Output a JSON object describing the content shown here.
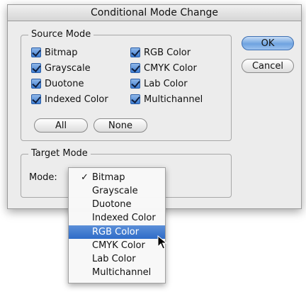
{
  "dialog": {
    "title": "Conditional Mode Change"
  },
  "source_mode": {
    "title": "Source Mode",
    "items": [
      {
        "label": "Bitmap",
        "checked": true
      },
      {
        "label": "Grayscale",
        "checked": true
      },
      {
        "label": "Duotone",
        "checked": true
      },
      {
        "label": "Indexed Color",
        "checked": true
      },
      {
        "label": "RGB Color",
        "checked": true
      },
      {
        "label": "CMYK Color",
        "checked": true
      },
      {
        "label": "Lab Color",
        "checked": true
      },
      {
        "label": "Multichannel",
        "checked": true
      }
    ],
    "all_label": "All",
    "none_label": "None"
  },
  "buttons": {
    "ok_label": "OK",
    "cancel_label": "Cancel"
  },
  "target_mode": {
    "title": "Target Mode",
    "mode_label": "Mode:",
    "checked_glyph": "✓",
    "options": [
      "Bitmap",
      "Grayscale",
      "Duotone",
      "Indexed Color",
      "RGB Color",
      "CMYK Color",
      "Lab Color",
      "Multichannel"
    ],
    "checked_option": "Bitmap",
    "highlighted_option": "RGB Color"
  },
  "colors": {
    "highlight": "#2f6cc8",
    "checkbox_fill": "#3f7fd3"
  }
}
